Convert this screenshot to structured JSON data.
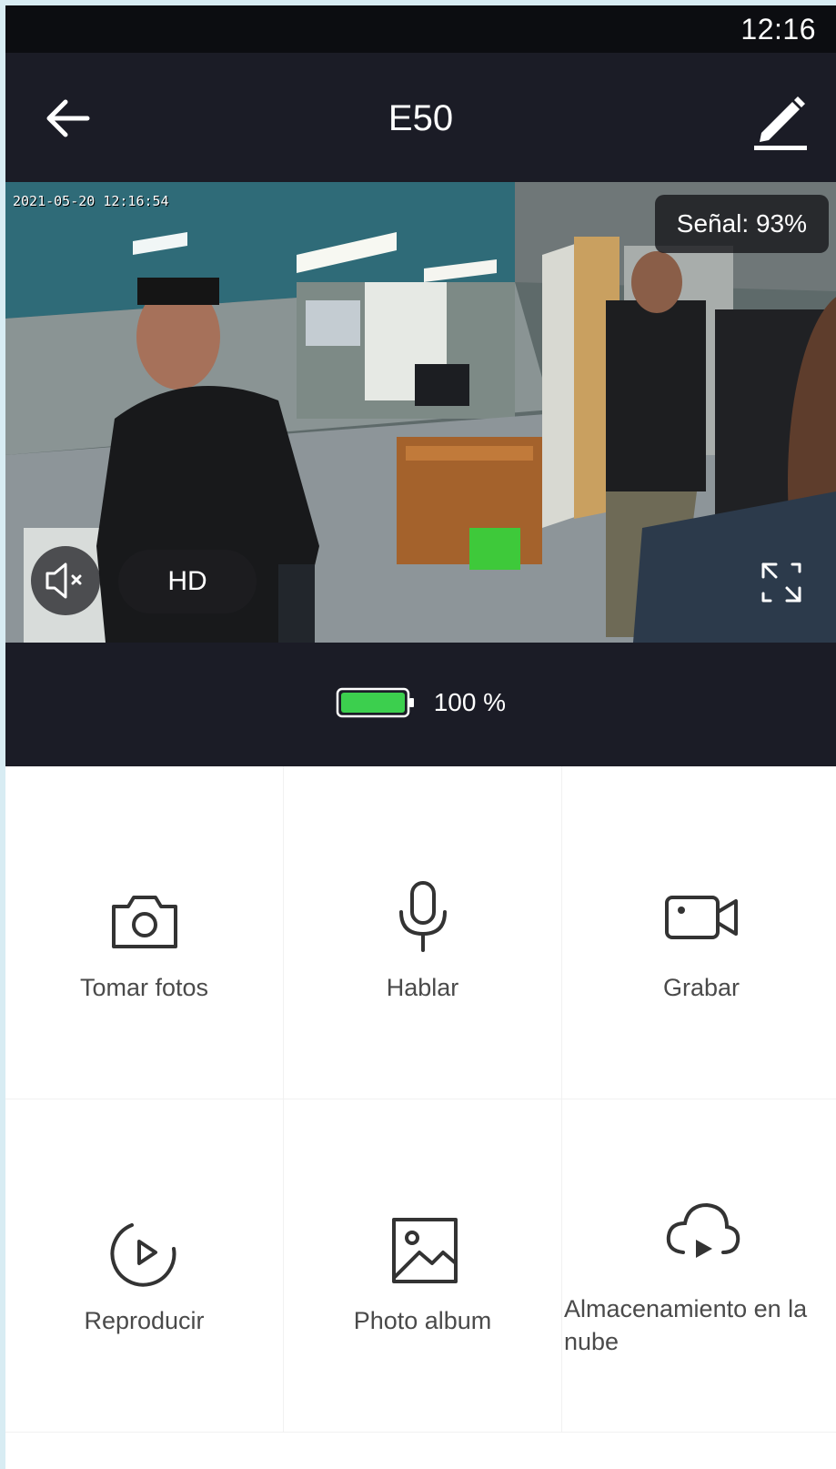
{
  "status_bar": {
    "time": "12:16"
  },
  "header": {
    "title": "E50"
  },
  "video": {
    "timestamp": "2021-05-20 12:16:54",
    "signal": "Señal: 93%",
    "quality": "HD"
  },
  "battery": {
    "text": "100 %",
    "level": 1.0,
    "color": "#3ccf4e"
  },
  "actions": [
    {
      "label": "Tomar fotos",
      "icon": "camera-icon"
    },
    {
      "label": "Hablar",
      "icon": "microphone-icon"
    },
    {
      "label": "Grabar",
      "icon": "video-camera-icon"
    },
    {
      "label": "Reproducir",
      "icon": "playback-icon"
    },
    {
      "label": "Photo album",
      "icon": "image-icon"
    },
    {
      "label": "Almacenamiento en la nube",
      "icon": "cloud-play-icon"
    }
  ],
  "colors": {
    "header_bg": "#1b1c26",
    "status_bg": "#0c0d11",
    "icon": "#333333",
    "label": "#4a4a4a"
  }
}
